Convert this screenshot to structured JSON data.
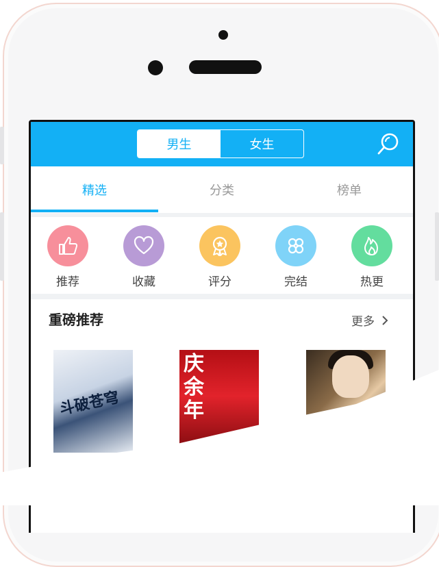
{
  "segment": {
    "male": "男生",
    "female": "女生",
    "selected": "男生"
  },
  "tabs": [
    {
      "label": "精选",
      "active": true
    },
    {
      "label": "分类",
      "active": false
    },
    {
      "label": "榜单",
      "active": false
    }
  ],
  "categories": [
    {
      "label": "推荐",
      "icon": "thumbs-up-icon",
      "color": "#f78f9b"
    },
    {
      "label": "收藏",
      "icon": "heart-icon",
      "color": "#b89bd6"
    },
    {
      "label": "评分",
      "icon": "medal-icon",
      "color": "#fbc45f"
    },
    {
      "label": "完结",
      "icon": "clover-icon",
      "color": "#7fd3f8"
    },
    {
      "label": "热更",
      "icon": "flame-icon",
      "color": "#63dd9e"
    }
  ],
  "section": {
    "title": "重磅推荐",
    "more": "更多"
  },
  "books": [
    {
      "cover_title": "斗破苍穹"
    },
    {
      "cover_title": "庆余年"
    },
    {
      "cover_title": ""
    }
  ],
  "colors": {
    "accent": "#13b0f5",
    "divider": "#f0f2f4"
  }
}
